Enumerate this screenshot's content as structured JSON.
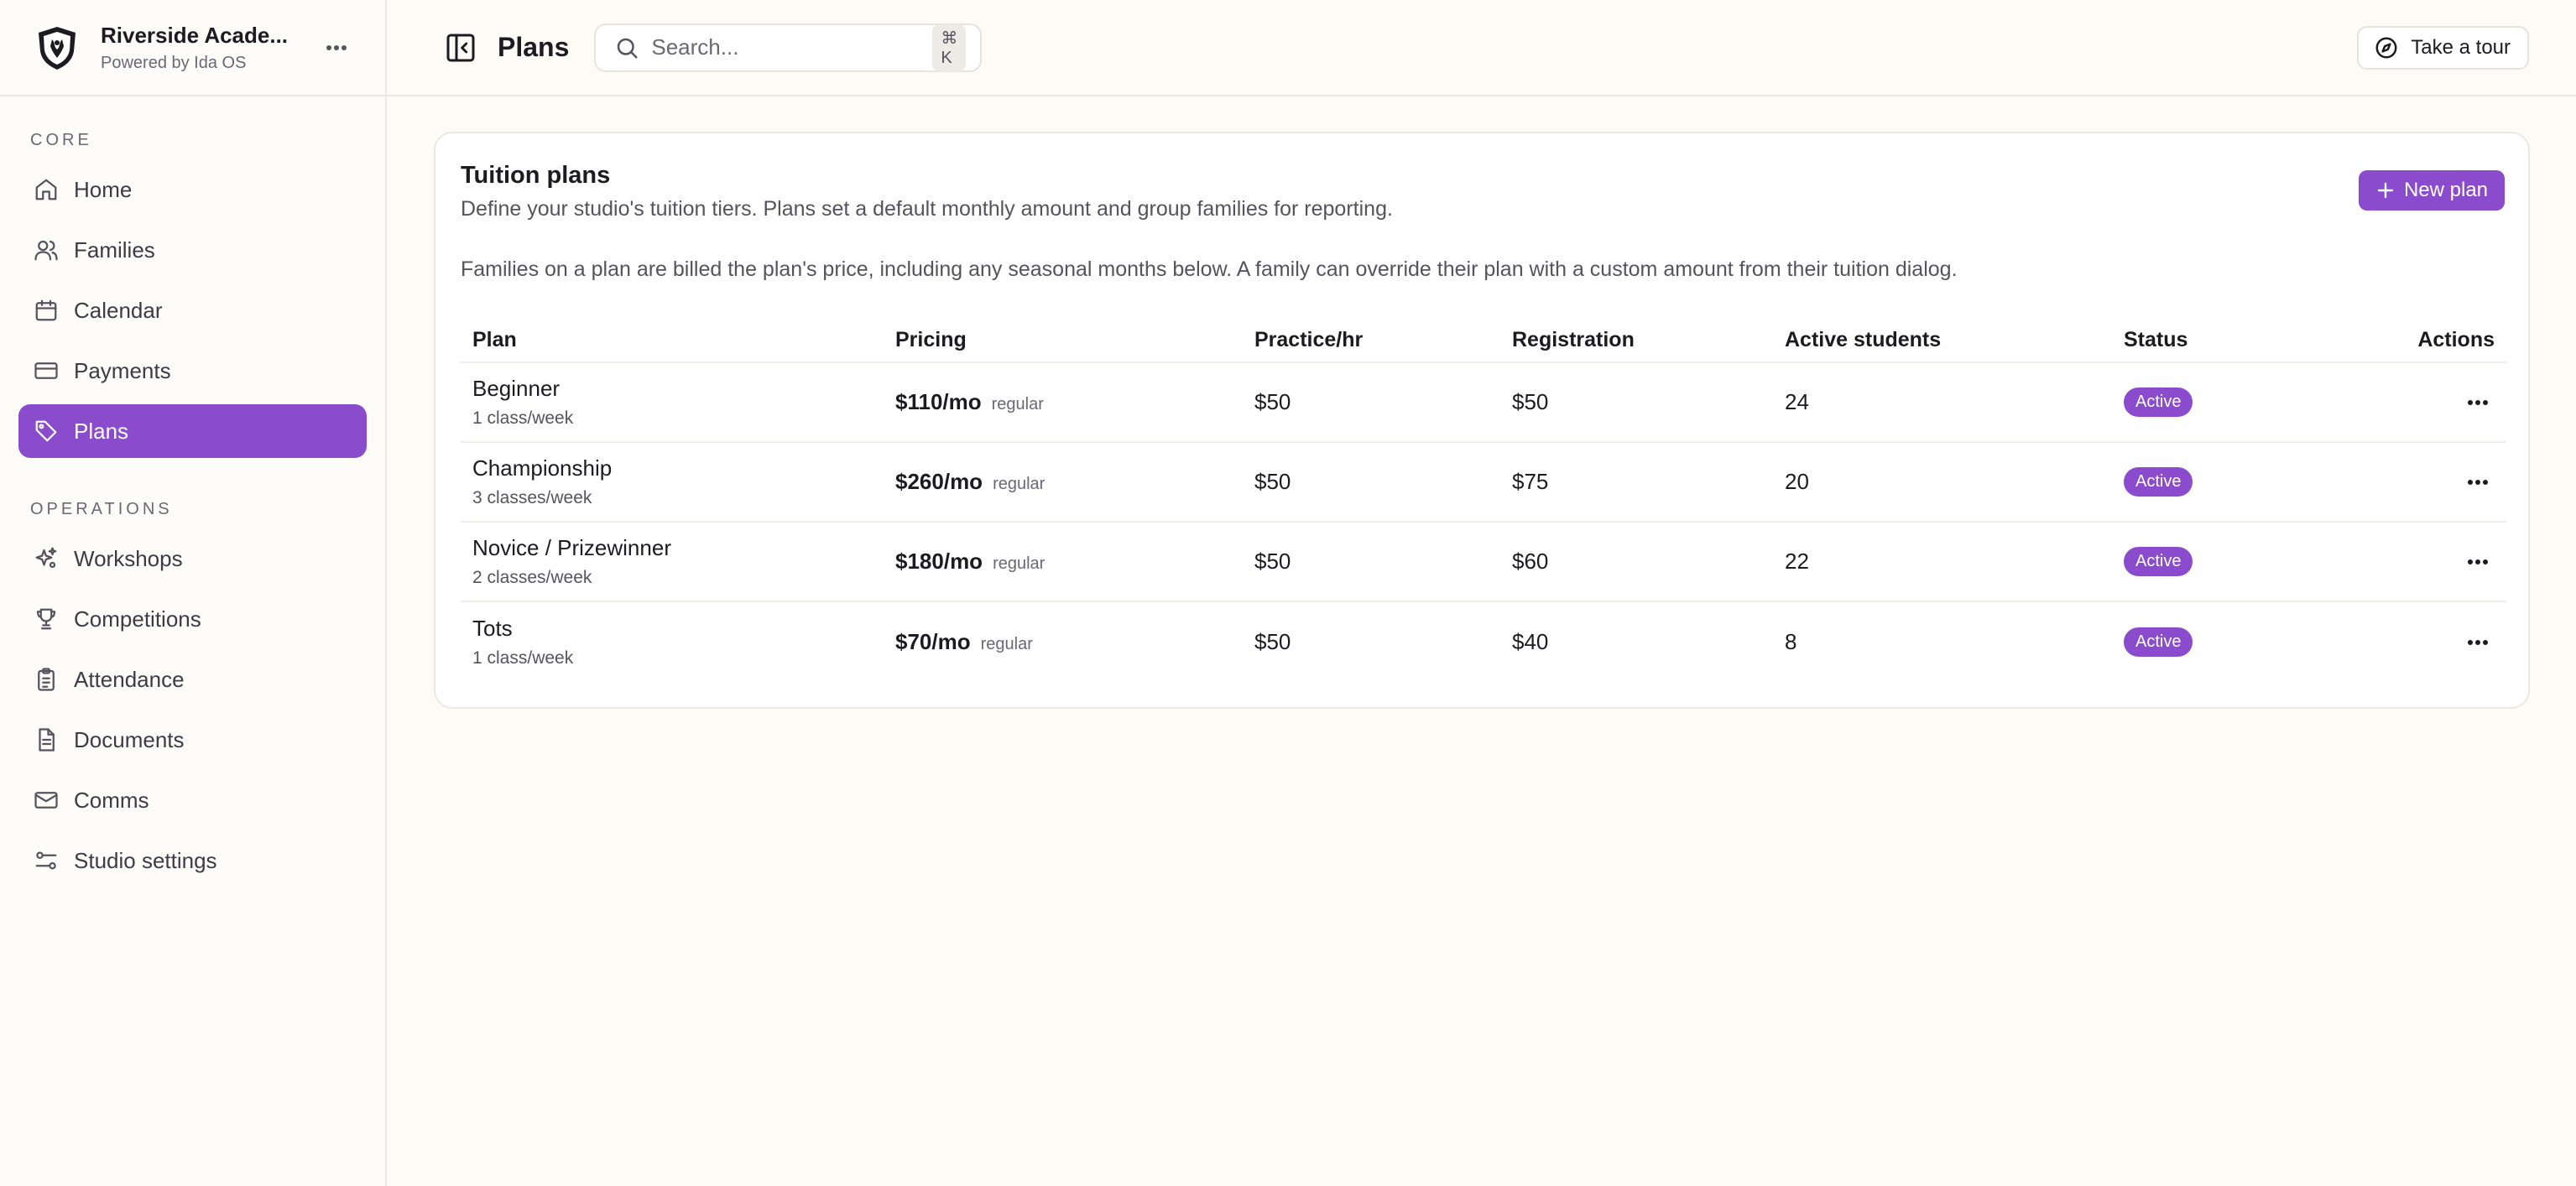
{
  "brand": {
    "name": "Riverside Acade...",
    "subtitle": "Powered by Ida OS"
  },
  "sidebar": {
    "sections": [
      {
        "label": "CORE",
        "items": [
          {
            "label": "Home",
            "icon": "home-icon"
          },
          {
            "label": "Families",
            "icon": "users-icon"
          },
          {
            "label": "Calendar",
            "icon": "calendar-icon"
          },
          {
            "label": "Payments",
            "icon": "credit-card-icon"
          },
          {
            "label": "Plans",
            "icon": "tag-icon",
            "active": true
          }
        ]
      },
      {
        "label": "OPERATIONS",
        "items": [
          {
            "label": "Workshops",
            "icon": "sparkles-icon"
          },
          {
            "label": "Competitions",
            "icon": "trophy-icon"
          },
          {
            "label": "Attendance",
            "icon": "clipboard-icon"
          },
          {
            "label": "Documents",
            "icon": "document-icon"
          },
          {
            "label": "Comms",
            "icon": "mail-icon"
          },
          {
            "label": "Studio settings",
            "icon": "settings-sliders-icon"
          }
        ]
      }
    ]
  },
  "header": {
    "title": "Plans",
    "search_placeholder": "Search...",
    "search_shortcut": "⌘ K",
    "tour_label": "Take a tour"
  },
  "card": {
    "title": "Tuition plans",
    "description": "Define your studio's tuition tiers. Plans set a default monthly amount and group families for reporting.",
    "note": "Families on a plan are billed the plan's price, including any seasonal months below. A family can override their plan with a custom amount from their tuition dialog.",
    "new_button": "New plan"
  },
  "table": {
    "headers": {
      "plan": "Plan",
      "pricing": "Pricing",
      "practice": "Practice/hr",
      "registration": "Registration",
      "active_students": "Active students",
      "status": "Status",
      "actions": "Actions"
    },
    "rows": [
      {
        "name": "Beginner",
        "frequency": "1 class/week",
        "price": "$110/mo",
        "price_type": "regular",
        "practice": "$50",
        "registration": "$50",
        "students": "24",
        "status": "Active"
      },
      {
        "name": "Championship",
        "frequency": "3 classes/week",
        "price": "$260/mo",
        "price_type": "regular",
        "practice": "$50",
        "registration": "$75",
        "students": "20",
        "status": "Active"
      },
      {
        "name": "Novice / Prizewinner",
        "frequency": "2 classes/week",
        "price": "$180/mo",
        "price_type": "regular",
        "practice": "$50",
        "registration": "$60",
        "students": "22",
        "status": "Active"
      },
      {
        "name": "Tots",
        "frequency": "1 class/week",
        "price": "$70/mo",
        "price_type": "regular",
        "practice": "$50",
        "registration": "$40",
        "students": "8",
        "status": "Active"
      }
    ]
  },
  "colors": {
    "accent": "#8a4ccc",
    "background": "#fcfbf6",
    "text": "#1c1b22"
  }
}
